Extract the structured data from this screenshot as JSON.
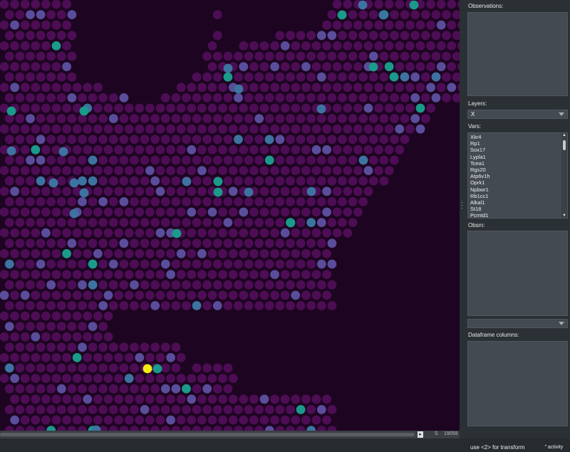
{
  "viewer": {
    "grid": {
      "background_color": "#1d0522",
      "base_spot_color": "#4d0d54",
      "palette": [
        "#5a4d9b",
        "#3d73a0",
        "#1a9a8a",
        "#f4ea12"
      ]
    },
    "scrollbar": {
      "arrow": "▸",
      "s_label": "S",
      "count": "19058"
    }
  },
  "panel": {
    "observations_label": "Observations:",
    "layers_label": "Layers:",
    "layers_value": "X",
    "vars_label": "Vars:",
    "vars_items": [
      "Xkr4",
      "Rp1",
      "Sox17",
      "Lypla1",
      "Tcea1",
      "Rgs20",
      "Atp6v1h",
      "Oprk1",
      "Npbwr1",
      "Rb1cc1",
      "Alkal1",
      "St18",
      "Pcmtd1"
    ],
    "obsm_label": "Obsm:",
    "obsm_dropdown_value": "",
    "dataframe_columns_label": "Dataframe columns:"
  },
  "footer": {
    "status_text": "use <2> for transform",
    "activity_label": "activity",
    "activity_icon": "chevron-up-icon"
  }
}
